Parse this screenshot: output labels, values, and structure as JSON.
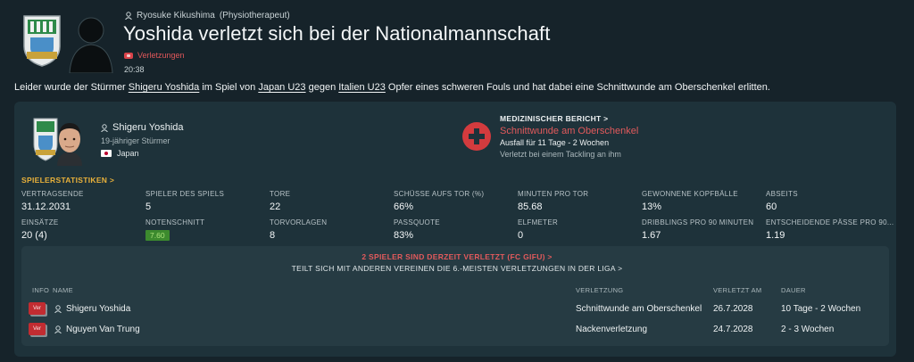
{
  "header": {
    "sender": "Ryosuke Kikushima",
    "sender_role": "(Physiotherapeut)",
    "title": "Yoshida verletzt sich bei der Nationalmannschaft",
    "tag": "Verletzungen",
    "time": "20:38"
  },
  "message": {
    "part1": "Leider wurde der Stürmer ",
    "player_link": "Shigeru Yoshida",
    "part2": " im Spiel von ",
    "team1_link": "Japan U23",
    "part3": " gegen ",
    "team2_link": "Italien U23",
    "part4": " Opfer eines schweren Fouls und hat dabei eine Schnittwunde am Oberschenkel erlitten."
  },
  "player": {
    "name": "Shigeru Yoshida",
    "description": "19-jähriger Stürmer",
    "nationality": "Japan"
  },
  "medical": {
    "heading": "MEDIZINISCHER BERICHT >",
    "diagnosis": "Schnittwunde am Oberschenkel",
    "duration": "Ausfall für 11 Tage - 2 Wochen",
    "cause": "Verletzt bei einem Tackling an ihm"
  },
  "stats": {
    "heading": "SPIELERSTATISTIKEN >",
    "row1": [
      {
        "label": "VERTRAGSENDE",
        "value": "31.12.2031"
      },
      {
        "label": "SPIELER DES SPIELS",
        "value": "5"
      },
      {
        "label": "TORE",
        "value": "22"
      },
      {
        "label": "SCHÜSSE AUFS TOR (%)",
        "value": "66%"
      },
      {
        "label": "MINUTEN PRO TOR",
        "value": "85.68"
      },
      {
        "label": "GEWONNENE KOPFBÄLLE",
        "value": "13%"
      },
      {
        "label": "ABSEITS",
        "value": "60"
      }
    ],
    "row2": [
      {
        "label": "EINSÄTZE",
        "value": "20 (4)"
      },
      {
        "label": "NOTENSCHNITT",
        "value": "7.60"
      },
      {
        "label": "TORVORLAGEN",
        "value": "8"
      },
      {
        "label": "PASSQUOTE",
        "value": "83%"
      },
      {
        "label": "ELFMETER",
        "value": "0"
      },
      {
        "label": "DRIBBLINGS PRO 90 MINUTEN",
        "value": "1.67"
      },
      {
        "label": "ENTSCHEIDENDE PÄSSE PRO 90...",
        "value": "1.19"
      }
    ]
  },
  "injuries": {
    "count_text": "2 SPIELER SIND DERZEIT VERLETZT (FC GIFU) >",
    "rank_text": "TEILT SICH MIT ANDEREN VEREINEN DIE 6.-MEISTEN VERLETZUNGEN IN DER LIGA >",
    "columns": {
      "info": "INFO",
      "name": "NAME",
      "injury": "VERLETZUNG",
      "since": "VERLETZT AM",
      "duration": "DAUER"
    },
    "rows": [
      {
        "badge": "Ver",
        "name": "Shigeru Yoshida",
        "injury": "Schnittwunde am Oberschenkel",
        "since": "26.7.2028",
        "duration": "10 Tage - 2 Wochen"
      },
      {
        "badge": "Ver",
        "name": "Nguyen Van Trung",
        "injury": "Nackenverletzung",
        "since": "24.7.2028",
        "duration": "2 - 3 Wochen"
      }
    ]
  },
  "colors": {
    "background": "#16232a",
    "panel": "#1e323a",
    "accent_gold": "#e9b13a",
    "injury_red": "#e25a5c"
  }
}
